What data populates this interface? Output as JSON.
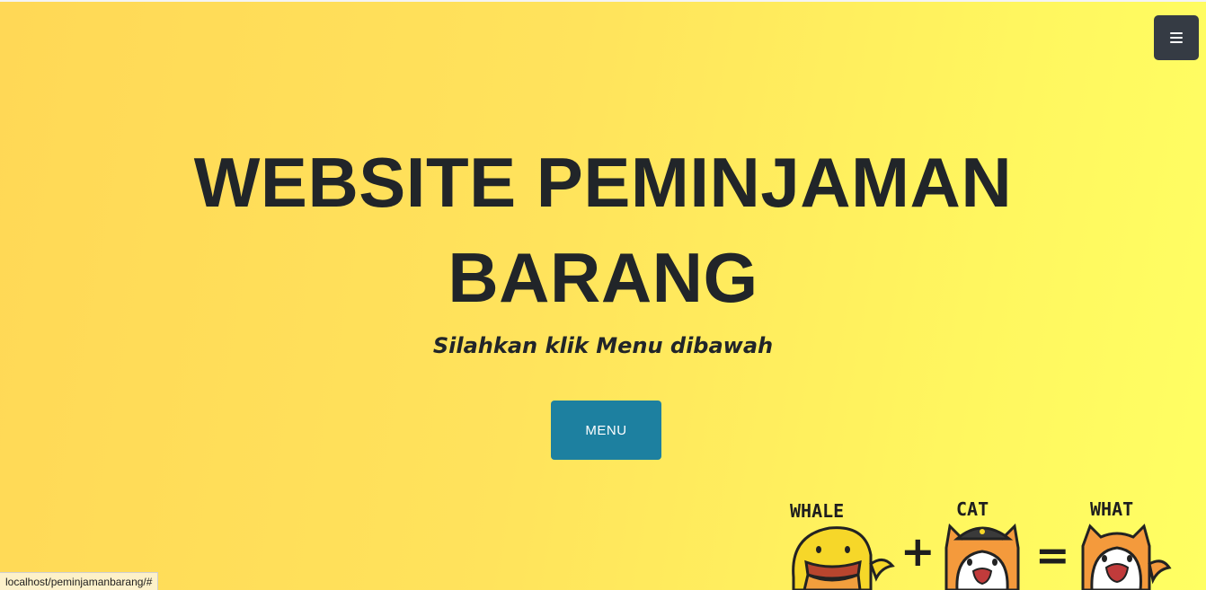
{
  "navbar": {
    "toggle_icon": "hamburger-icon"
  },
  "hero": {
    "title": "WEBSITE PEMINJAMAN BARANG",
    "subtitle": "Silahkan klik Menu dibawah",
    "button_label": "MENU"
  },
  "illustration": {
    "labels": [
      "WHALE",
      "CAT",
      "WHAT"
    ],
    "operators": [
      "+",
      "="
    ]
  },
  "status_bar": {
    "url": "localhost/peminjamanbarang/#"
  },
  "colors": {
    "background_start": "#ffd856",
    "background_end": "#ffff63",
    "toggle_bg": "#353b44",
    "button_bg": "#1d80a0",
    "text": "#212529"
  }
}
